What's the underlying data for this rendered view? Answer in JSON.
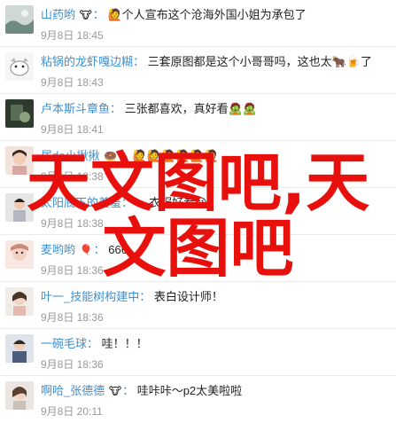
{
  "colors": {
    "username": "#3e8fd1",
    "timestamp": "#999999",
    "content": "#222222",
    "watermark": "#e8100c"
  },
  "comments": [
    {
      "username": "山药哟",
      "badge": "🐮",
      "badge_icon": "cow-face-icon",
      "content": "🙋个人宣布这个沧海外国小姐为承包了",
      "timestamp": "9月8日 18:45"
    },
    {
      "username": "粘锅的龙虾嘎边糊",
      "badge": "",
      "badge_icon": "",
      "content": "三套原图都是这个小哥哥吗，这也太🐂🍺了",
      "timestamp": "9月8日 18:43"
    },
    {
      "username": "卢本斯斗章鱼",
      "badge": "",
      "badge_icon": "",
      "content": "三张都喜欢，真好看🧟🧟",
      "timestamp": "9月8日 18:41"
    },
    {
      "username": "居de小揪揪",
      "badge": "🍩",
      "badge_icon": "donut-icon",
      "content": "🙋🙋🙋🙋🙋🙋",
      "timestamp": "9月8日 18:38"
    },
    {
      "username": "太阳底下的羞羞",
      "badge": "",
      "badge_icon": "",
      "content": "... 衣服好看😘",
      "timestamp": "9月8日 18:38"
    },
    {
      "username": "麦哟哟",
      "badge": "🎈",
      "badge_icon": "balloon-icon",
      "content": "666",
      "timestamp": "9月8日 18:36"
    },
    {
      "username": "叶一_技能树构建中",
      "badge": "",
      "badge_icon": "",
      "content": "表白设计师！",
      "timestamp": "9月8日 18:36"
    },
    {
      "username": "一碗毛球",
      "badge": "",
      "badge_icon": "",
      "content": "哇！！！",
      "timestamp": "9月8日 18:36"
    },
    {
      "username": "啊哈_张德德",
      "badge": "🐮",
      "badge_icon": "cow-face-icon",
      "content": "哇咔咔～p2太美啦啦",
      "timestamp": "9月8日 20:11"
    }
  ],
  "watermark": {
    "line1": "天文图吧,天",
    "line2": "文图吧"
  }
}
